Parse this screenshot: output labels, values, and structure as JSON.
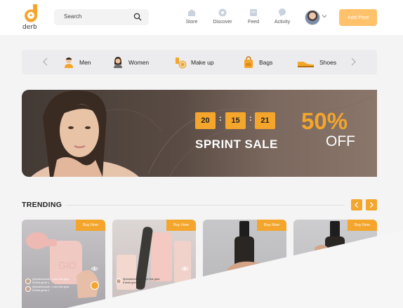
{
  "header": {
    "logo_text": "derb",
    "search_placeholder": "Search",
    "nav": [
      {
        "label": "Store",
        "icon": "store-icon"
      },
      {
        "label": "Discover",
        "icon": "discover-icon"
      },
      {
        "label": "Feed",
        "icon": "feed-icon"
      },
      {
        "label": "Activity",
        "icon": "activity-icon"
      }
    ],
    "add_post_label": "Add Post",
    "accent": "#f4a52c"
  },
  "categories": {
    "items": [
      {
        "label": "Men",
        "icon": "man-icon"
      },
      {
        "label": "Women",
        "icon": "woman-icon"
      },
      {
        "label": "Make up",
        "icon": "makeup-icon"
      },
      {
        "label": "Bags",
        "icon": "bag-icon"
      },
      {
        "label": "Shoes",
        "icon": "shoe-icon"
      }
    ]
  },
  "banner": {
    "timer": [
      "20",
      "15",
      "21"
    ],
    "title": "SPRINT SALE",
    "percent": "50%",
    "off": "OFF"
  },
  "trending": {
    "title": "TRENDING",
    "cards": [
      {
        "buy_label": "Buy Now",
        "line1": "@modelclouds : Love this glow",
        "line2": "It feels great :)"
      },
      {
        "buy_label": "Buy Now",
        "line1": "@modelclouds : Love this glow",
        "line2": "It feels great :)"
      },
      {
        "buy_label": "Buy Now",
        "line1": "",
        "line2": ""
      },
      {
        "buy_label": "Buy Now",
        "line1": "",
        "line2": ""
      }
    ]
  }
}
